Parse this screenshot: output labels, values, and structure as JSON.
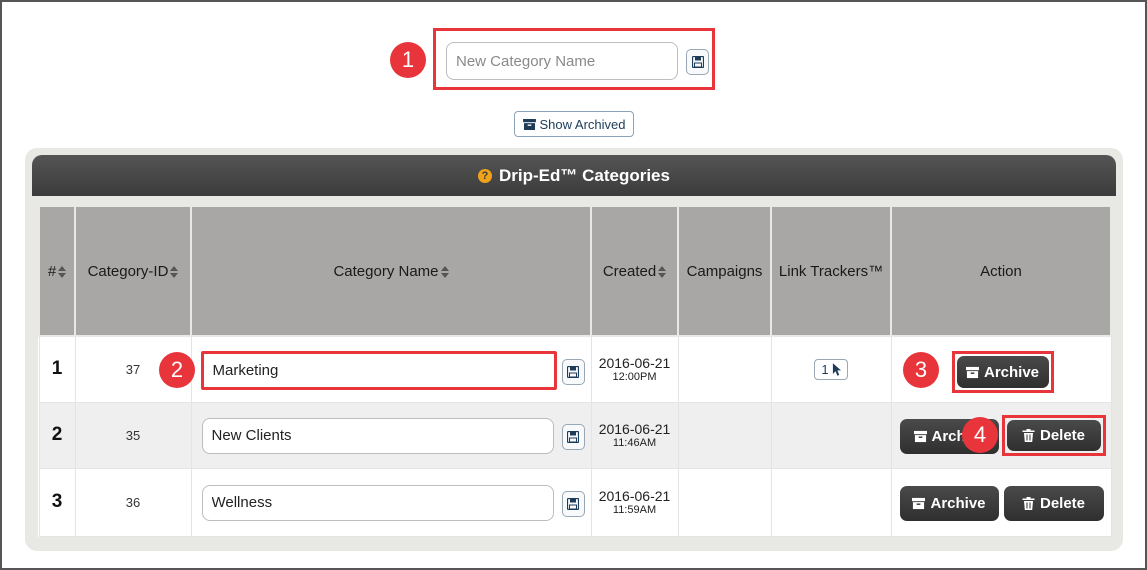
{
  "new_category": {
    "placeholder": "New Category Name"
  },
  "show_archived_label": "Show Archived",
  "panel_title": "Drip-Ed™ Categories",
  "columns": [
    "#",
    "Category-ID",
    "Category Name",
    "Created",
    "Campaigns",
    "Link Trackers™",
    "Action"
  ],
  "rows": [
    {
      "num": "1",
      "id": "37",
      "name": "Marketing",
      "date": "2016-06-21",
      "time": "12:00PM",
      "link_trackers": "1",
      "archive_label": "Archive",
      "delete_label": ""
    },
    {
      "num": "2",
      "id": "35",
      "name": "New Clients",
      "date": "2016-06-21",
      "time": "11:46AM",
      "link_trackers": "",
      "archive_label": "Archive",
      "delete_label": "Delete"
    },
    {
      "num": "3",
      "id": "36",
      "name": "Wellness",
      "date": "2016-06-21",
      "time": "11:59AM",
      "link_trackers": "",
      "archive_label": "Archive",
      "delete_label": "Delete"
    }
  ],
  "callouts": [
    "1",
    "2",
    "3",
    "4"
  ],
  "colors": {
    "callout": "#e8353b",
    "header": "#3b3b3b",
    "table_header": "#a8a7a6",
    "help_icon": "#f0a31a"
  },
  "icons": {
    "save": "floppy-disk-icon",
    "archive": "archive-box-icon",
    "delete": "trash-icon",
    "help": "question-circle-icon",
    "sort": "sort-arrows-icon",
    "cursor": "mouse-pointer-icon"
  }
}
